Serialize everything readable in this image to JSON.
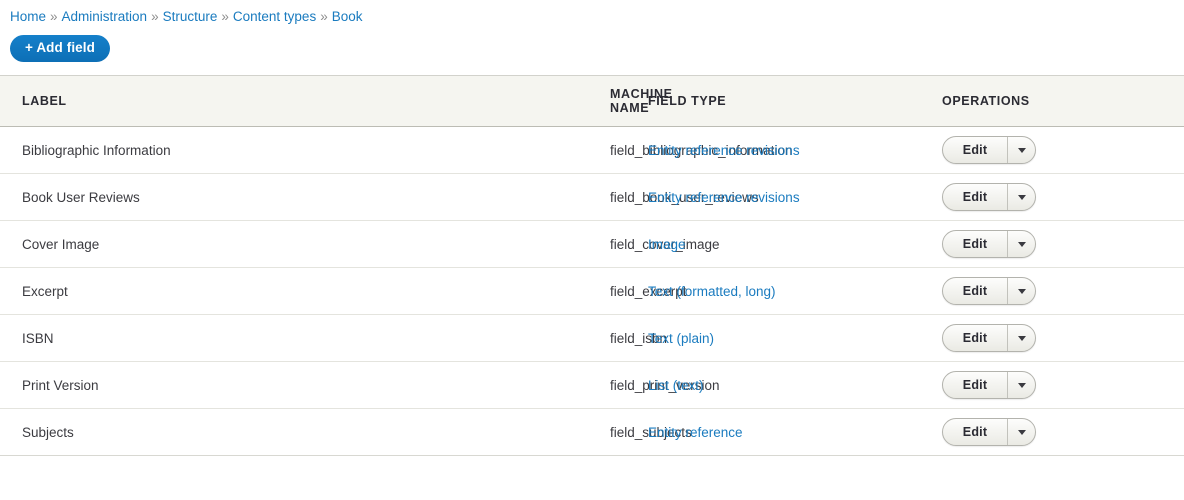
{
  "breadcrumb": {
    "separator": "»",
    "items": [
      {
        "label": "Home"
      },
      {
        "label": "Administration"
      },
      {
        "label": "Structure"
      },
      {
        "label": "Content types"
      },
      {
        "label": "Book"
      }
    ]
  },
  "toolbar": {
    "add_field_label": "+ Add field"
  },
  "table": {
    "columns": [
      {
        "key": "label",
        "label": "LABEL"
      },
      {
        "key": "machine",
        "label": "MACHINE NAME"
      },
      {
        "key": "type",
        "label": "FIELD TYPE"
      },
      {
        "key": "ops",
        "label": "OPERATIONS"
      }
    ],
    "rows": [
      {
        "label": "Bibliographic Information",
        "machine_name": "field_bibliographic_information",
        "field_type": "Entity reference revisions",
        "edit_label": "Edit"
      },
      {
        "label": "Book User Reviews",
        "machine_name": "field_book_user_reviews",
        "field_type": "Entity reference revisions",
        "edit_label": "Edit"
      },
      {
        "label": "Cover Image",
        "machine_name": "field_cover_image",
        "field_type": "Image",
        "edit_label": "Edit"
      },
      {
        "label": "Excerpt",
        "machine_name": "field_excerpt",
        "field_type": "Text (formatted, long)",
        "edit_label": "Edit"
      },
      {
        "label": "ISBN",
        "machine_name": "field_isbn",
        "field_type": "Text (plain)",
        "edit_label": "Edit"
      },
      {
        "label": "Print Version",
        "machine_name": "field_print_version",
        "field_type": "List (text)",
        "edit_label": "Edit"
      },
      {
        "label": "Subjects",
        "machine_name": "field_subjects",
        "field_type": "Entity reference",
        "edit_label": "Edit"
      }
    ]
  },
  "colors": {
    "link_blue": "#1a7bbf",
    "primary_button": "#0f74bd",
    "header_background": "#f5f5f0",
    "row_border": "#e4e4de",
    "text": "#3b3b40"
  }
}
